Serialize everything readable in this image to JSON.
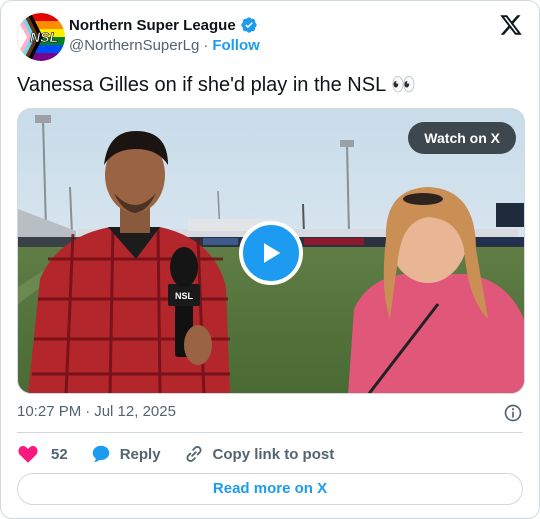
{
  "author": {
    "display_name": "Northern Super League",
    "handle": "@NorthernSuperLg",
    "separator": "·",
    "follow_label": "Follow",
    "avatar_text": "NSL"
  },
  "tweet": {
    "text": "Vanessa Gilles on if she'd play in the NSL 👀"
  },
  "media": {
    "watch_label": "Watch on X",
    "play_icon": "play-icon"
  },
  "meta": {
    "time": "10:27 PM",
    "separator": "·",
    "date": "Jul 12, 2025"
  },
  "actions": {
    "like_count": "52",
    "reply_label": "Reply",
    "copy_label": "Copy link to post"
  },
  "read_more_label": "Read more on X",
  "colors": {
    "accent": "#1d9bf0",
    "like": "#f91880",
    "muted": "#536471",
    "text": "#0f1419"
  }
}
